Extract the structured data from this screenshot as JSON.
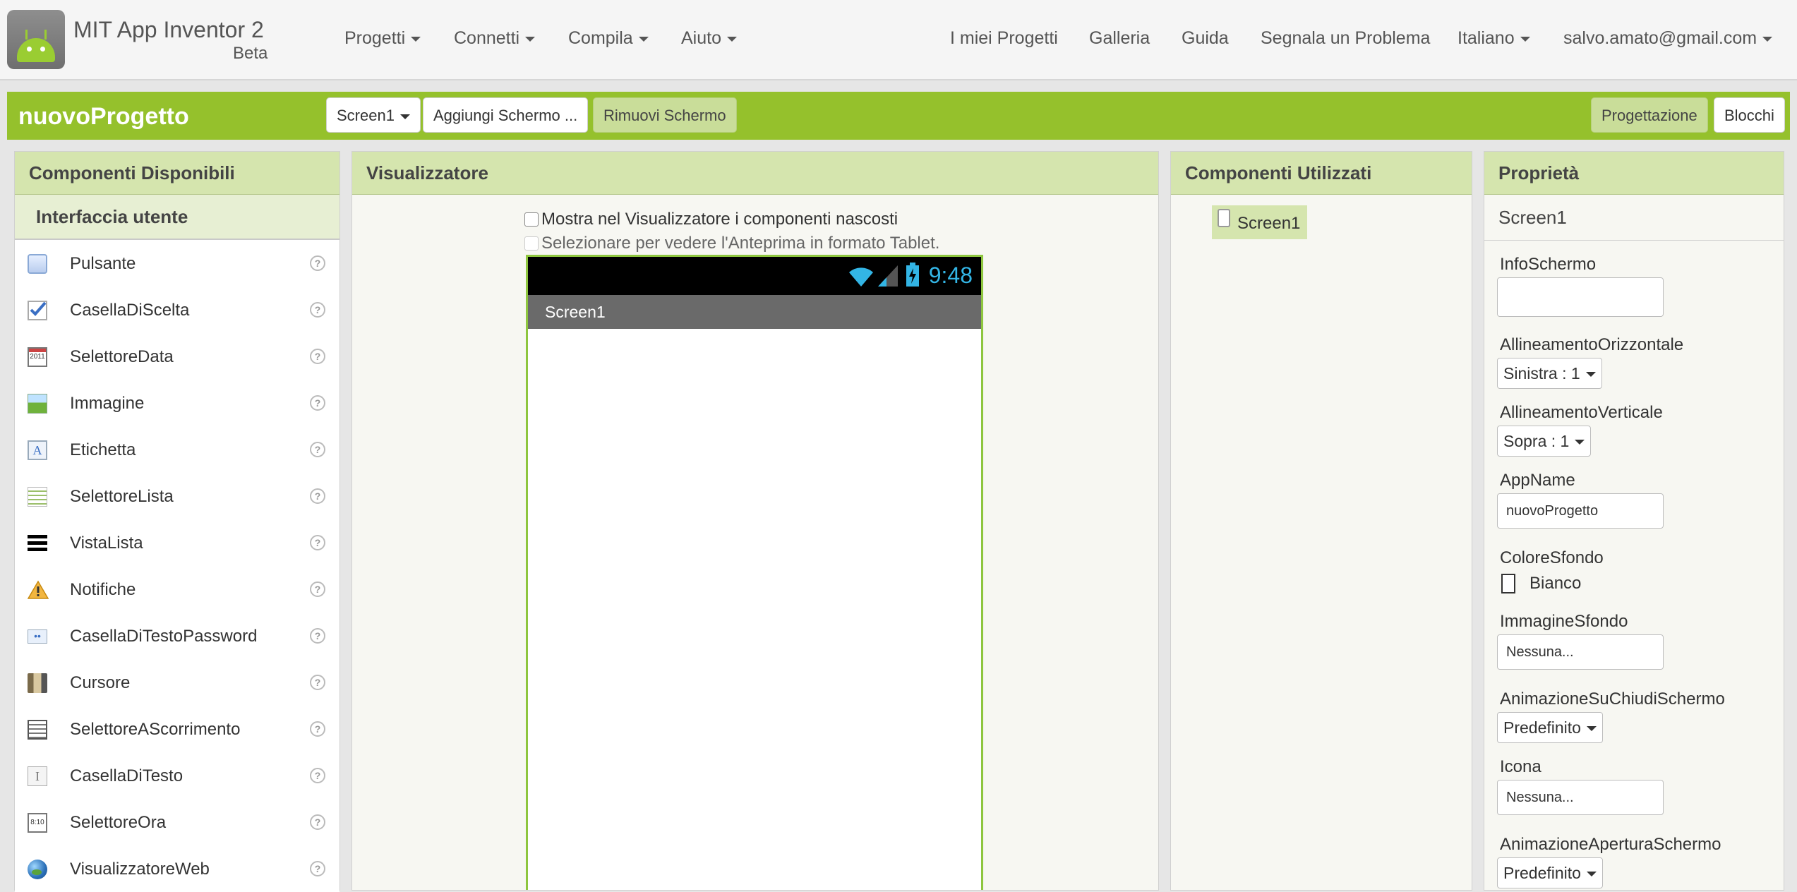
{
  "header": {
    "app_title": "MIT App Inventor 2",
    "app_subtitle": "Beta",
    "menus": [
      "Progetti",
      "Connetti",
      "Compila",
      "Aiuto"
    ],
    "links": [
      "I miei Progetti",
      "Galleria",
      "Guida",
      "Segnala un Problema"
    ],
    "language": "Italiano",
    "user": "salvo.amato@gmail.com"
  },
  "project": {
    "name": "nuovoProgetto",
    "screen_select": "Screen1",
    "add_screen": "Aggiungi Schermo ...",
    "remove_screen": "Rimuovi Schermo",
    "designer": "Progettazione",
    "blocks": "Blocchi"
  },
  "palette": {
    "title": "Componenti Disponibili",
    "category": "Interfaccia utente",
    "help_glyph": "?",
    "items": [
      {
        "label": "Pulsante",
        "icon": "button-icon"
      },
      {
        "label": "CasellaDiScelta",
        "icon": "checkbox-icon"
      },
      {
        "label": "SelettoreData",
        "icon": "calendar-icon"
      },
      {
        "label": "Immagine",
        "icon": "image-icon"
      },
      {
        "label": "Etichetta",
        "icon": "label-icon"
      },
      {
        "label": "SelettoreLista",
        "icon": "list-picker-icon"
      },
      {
        "label": "VistaLista",
        "icon": "list-view-icon"
      },
      {
        "label": "Notifiche",
        "icon": "warning-icon"
      },
      {
        "label": "CasellaDiTestoPassword",
        "icon": "password-icon"
      },
      {
        "label": "Cursore",
        "icon": "slider-icon"
      },
      {
        "label": "SelettoreAScorrimento",
        "icon": "spinner-icon"
      },
      {
        "label": "CasellaDiTesto",
        "icon": "textbox-icon"
      },
      {
        "label": "SelettoreOra",
        "icon": "clock-icon"
      },
      {
        "label": "VisualizzatoreWeb",
        "icon": "globe-icon"
      }
    ]
  },
  "viewer": {
    "title": "Visualizzatore",
    "show_hidden": "Mostra nel Visualizzatore i componenti nascosti",
    "tablet_preview": "Selezionare per vedere l'Anteprima in formato Tablet.",
    "phone_time": "9:48",
    "screen_title": "Screen1"
  },
  "components": {
    "title": "Componenti Utilizzati",
    "tree": [
      "Screen1"
    ]
  },
  "properties": {
    "title": "Proprietà",
    "selected": "Screen1",
    "info_label": "InfoSchermo",
    "info_value": "",
    "halign_label": "AllineamentoOrizzontale",
    "halign_value": "Sinistra : 1",
    "valign_label": "AllineamentoVerticale",
    "valign_value": "Sopra : 1",
    "appname_label": "AppName",
    "appname_value": "nuovoProgetto",
    "bgcolor_label": "ColoreSfondo",
    "bgcolor_value": "Bianco",
    "bgimage_label": "ImmagineSfondo",
    "bgimage_value": "Nessuna...",
    "close_anim_label": "AnimazioneSuChiudiSchermo",
    "close_anim_value": "Predefinito",
    "icon_label": "Icona",
    "icon_value": "Nessuna...",
    "open_anim_label": "AnimazioneAperturaSchermo",
    "open_anim_value": "Predefinito"
  },
  "colors": {
    "accent_green": "#95c12c",
    "header_green": "#d5e5ae",
    "phone_time_blue": "#33b5e5"
  }
}
